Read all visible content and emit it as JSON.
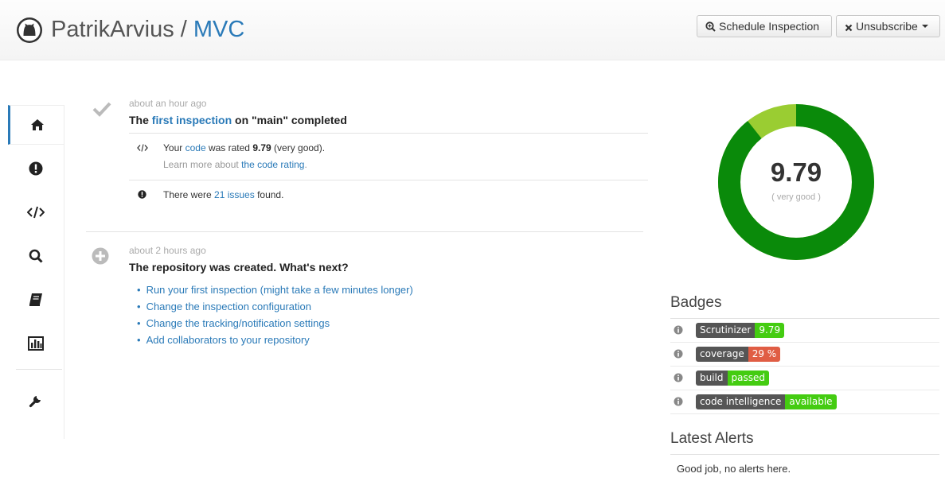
{
  "header": {
    "owner": "PatrikArvius",
    "separator": "/",
    "repo": "MVC",
    "schedule_label": "Schedule Inspection",
    "unsubscribe_label": "Unsubscribe"
  },
  "sidebar": {
    "items": [
      {
        "icon": "home-icon",
        "active": true
      },
      {
        "icon": "issues-icon"
      },
      {
        "icon": "code-icon"
      },
      {
        "icon": "search-icon"
      },
      {
        "icon": "book-icon"
      },
      {
        "icon": "chart-icon"
      },
      {
        "icon": "wrench-icon"
      }
    ]
  },
  "events": [
    {
      "time": "about an hour ago",
      "title_prefix": "The ",
      "title_link": "first inspection",
      "title_suffix": " on \"main\" completed",
      "rating": {
        "prefix": "Your ",
        "link": "code",
        "middle": " was rated ",
        "score": "9.79",
        "suffix": " (very good).",
        "learn_prefix": "Learn more about ",
        "learn_link": "the code rating",
        "learn_suffix": "."
      },
      "issues": {
        "prefix": "There were ",
        "link": "21 issues",
        "suffix": " found."
      }
    },
    {
      "time": "about 2 hours ago",
      "title": "The repository was created. What's next?",
      "links": [
        "Run your first inspection (might take a few minutes longer)",
        "Change the inspection configuration",
        "Change the tracking/notification settings",
        "Add collaborators to your repository"
      ]
    }
  ],
  "score": {
    "value": "9.79",
    "label": "( very good )",
    "fraction": 0.893,
    "colors": {
      "good": "#0a8a0a",
      "rest": "#9acd32"
    }
  },
  "badges": {
    "title": "Badges",
    "items": [
      {
        "left": "Scrutinizer",
        "right": "9.79",
        "color": "#4c1"
      },
      {
        "left": "coverage",
        "right": "29 %",
        "color": "#e05d44"
      },
      {
        "left": "build",
        "right": "passed",
        "color": "#4c1"
      },
      {
        "left": "code intelligence",
        "right": "available",
        "color": "#4c1"
      }
    ]
  },
  "alerts": {
    "title": "Latest Alerts",
    "text": "Good job, no alerts here."
  }
}
